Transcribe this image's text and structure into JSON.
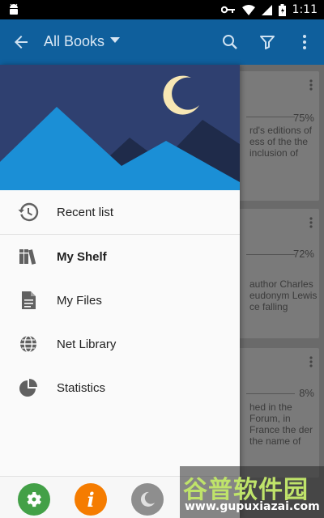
{
  "status_bar": {
    "time": "1:11"
  },
  "app_bar": {
    "title": "All Books"
  },
  "background_cards": [
    {
      "progress": "75%",
      "snippet": "rd's editions of ess of the the inclusion of"
    },
    {
      "progress": "72%",
      "snippet": "author Charles eudonym Lewis ce falling"
    },
    {
      "progress": "8%",
      "snippet": "hed in the Forum, in France the der the name of"
    }
  ],
  "drawer": {
    "menu": [
      {
        "label": "Recent list",
        "icon": "history-icon"
      },
      {
        "label": "My Shelf",
        "icon": "books-icon",
        "active": true
      },
      {
        "label": "My Files",
        "icon": "document-icon"
      },
      {
        "label": "Net Library",
        "icon": "globe-icon"
      },
      {
        "label": "Statistics",
        "icon": "pie-chart-icon"
      }
    ],
    "bottom_actions": [
      "settings-icon",
      "info-icon",
      "night-mode-icon"
    ]
  },
  "watermark": {
    "text": "谷普软件园",
    "url": "www.gupuxiazai.com"
  },
  "colors": {
    "app_bar": "#0f5f9c",
    "header": "#2f4070",
    "mountain_light": "#1b8fd6",
    "mountain_dark": "#1f2b4a",
    "moon": "#f7e7b4",
    "settings": "#43a047",
    "info": "#f57c00",
    "night": "#8e8e8e"
  }
}
